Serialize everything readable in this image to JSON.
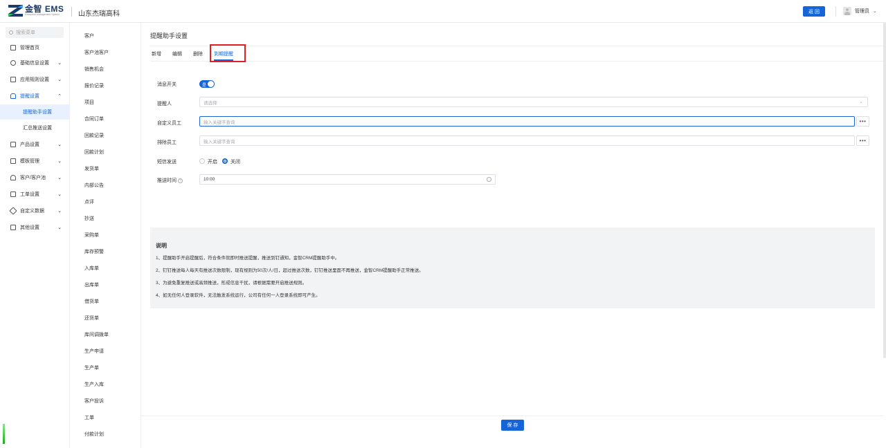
{
  "header": {
    "logo_title": "金智 EMS",
    "logo_sub": "Enterprise Management System",
    "company": "山东杰瑞高科",
    "back_label": "返 回",
    "user_name": "管理员",
    "brand_color": "#1565d8"
  },
  "sidebar": {
    "search_placeholder": "搜索菜单",
    "items": [
      {
        "label": "管理首页",
        "icon": "home-icon"
      },
      {
        "label": "基础信息设置",
        "icon": "settings-icon"
      },
      {
        "label": "应用规则设置",
        "icon": "document-icon"
      },
      {
        "label": "提醒设置",
        "icon": "bell-icon"
      },
      {
        "label": "产品设置",
        "icon": "box-icon"
      },
      {
        "label": "模板管理",
        "icon": "template-icon"
      },
      {
        "label": "客户/客户池",
        "icon": "users-icon"
      },
      {
        "label": "工单设置",
        "icon": "ticket-icon"
      },
      {
        "label": "自定义数据",
        "icon": "tools-icon"
      },
      {
        "label": "其他设置",
        "icon": "grid-icon"
      }
    ],
    "submenu": [
      "提醒助手设置",
      "汇总推送设置"
    ]
  },
  "midnav": {
    "items": [
      "客户",
      "客户池客户",
      "销售机会",
      "报价记录",
      "项目",
      "合同订单",
      "回款记录",
      "回款计划",
      "发货单",
      "内部公告",
      "点评",
      "抄送",
      "采购单",
      "库存预警",
      "入库单",
      "出库单",
      "借货单",
      "还货单",
      "库间调拨单",
      "生产申请",
      "生产单",
      "生产入库",
      "客户投诉",
      "工单",
      "付款计划"
    ]
  },
  "main": {
    "page_title": "提醒助手设置",
    "tabs": [
      "新增",
      "编辑",
      "删除",
      "到期提醒"
    ],
    "form": {
      "msg_switch_label": "消息开关",
      "msg_switch_value": "是",
      "reminder_label": "提醒人",
      "reminder_placeholder": "请选择",
      "custom_staff_label": "自定义员工",
      "custom_staff_placeholder": "输入关键字查询",
      "exclude_staff_label": "排除员工",
      "exclude_staff_placeholder": "输入关键字查询",
      "sms_label": "短信发送",
      "sms_on": "开启",
      "sms_off": "关闭",
      "push_time_label": "推送时间",
      "push_time_value": "10:00",
      "dots": "•••"
    },
    "desc": {
      "title": "说明",
      "lines": [
        "1、提醒助手开启提醒后，符合条件就即时推送提醒，推送到钉通知，金智CRM提醒助手中。",
        "2、钉钉推送每人每天有推送次数限制，现有规则为50次/人/日，超过推送次数，钉钉推送里面不再推送，金智CRM提醒助手正常推送。",
        "3、为避免重复推送或高频推送，形成信息干扰，请根据需要开启推送规则。",
        "4、如无任何人登录软件，无法触发系统运行，公司有任何一人登录系统即可产生。"
      ]
    },
    "save_label": "保 存"
  }
}
